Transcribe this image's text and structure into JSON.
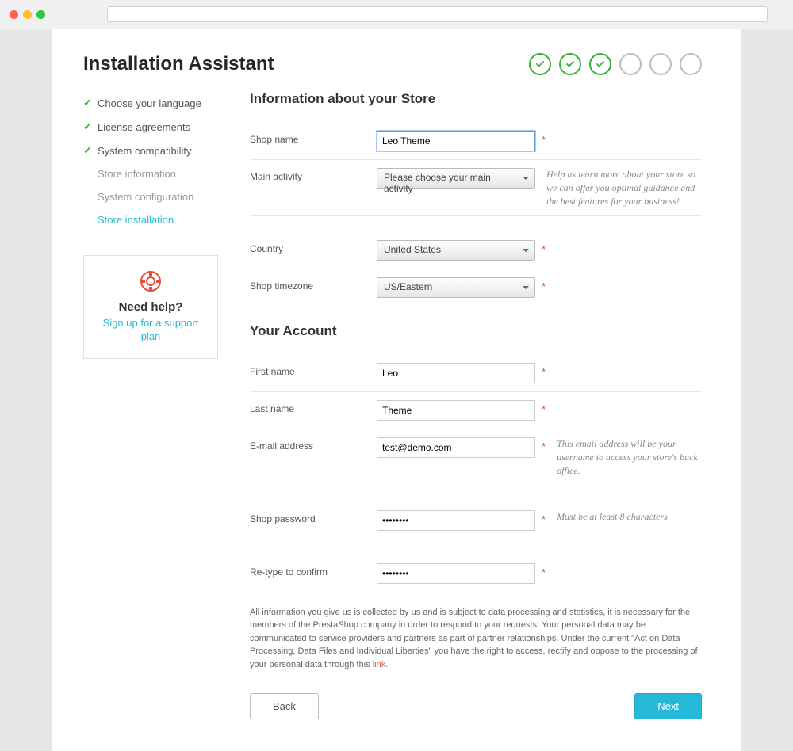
{
  "header": {
    "title": "Installation Assistant"
  },
  "progress": {
    "steps": [
      {
        "done": true
      },
      {
        "done": true
      },
      {
        "done": true
      },
      {
        "done": false
      },
      {
        "done": false
      },
      {
        "done": false
      }
    ]
  },
  "sidebar": {
    "items": [
      {
        "label": "Choose your language",
        "status": "done"
      },
      {
        "label": "License agreements",
        "status": "done"
      },
      {
        "label": "System compatibility",
        "status": "done"
      },
      {
        "label": "Store information",
        "status": "pending"
      },
      {
        "label": "System configuration",
        "status": "pending"
      },
      {
        "label": "Store installation",
        "status": "active"
      }
    ]
  },
  "help": {
    "heading": "Need help?",
    "link_text": "Sign up for a support plan"
  },
  "form": {
    "store_section_title": "Information about your Store",
    "account_section_title": "Your Account",
    "shop_name": {
      "label": "Shop name",
      "value": "Leo Theme"
    },
    "main_activity": {
      "label": "Main activity",
      "placeholder": "Please choose your main activity",
      "hint": "Help us learn more about your store so we can offer you optimal guidance and the best features for your business!"
    },
    "country": {
      "label": "Country",
      "value": "United States"
    },
    "timezone": {
      "label": "Shop timezone",
      "value": "US/Eastern"
    },
    "first_name": {
      "label": "First name",
      "value": "Leo"
    },
    "last_name": {
      "label": "Last name",
      "value": "Theme"
    },
    "email": {
      "label": "E-mail address",
      "value": "test@demo.com",
      "hint": "This email address will be your username to access your store's back office."
    },
    "password": {
      "label": "Shop password",
      "value": "••••••••",
      "hint": "Must be at least 8 characters"
    },
    "confirm": {
      "label": "Re-type to confirm",
      "value": "••••••••"
    }
  },
  "disclaimer": {
    "text": "All information you give us is collected by us and is subject to data processing and statistics, it is necessary for the members of the PrestaShop company in order to respond to your requests. Your personal data may be communicated to service providers and partners as part of partner relationships. Under the current \"Act on Data Processing, Data Files and Individual Liberties\" you have the right to access, rectify and oppose to the processing of your personal data through this ",
    "link": "link"
  },
  "buttons": {
    "back": "Back",
    "next": "Next"
  }
}
